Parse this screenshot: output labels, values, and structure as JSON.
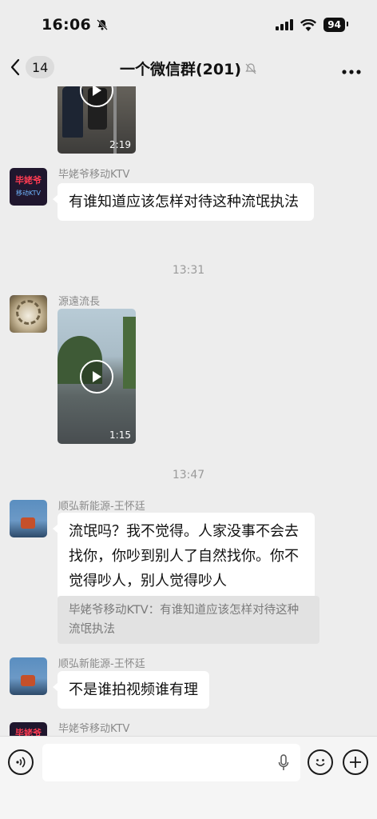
{
  "status_bar": {
    "time": "16:06",
    "battery": "94"
  },
  "nav": {
    "unread_count": "14",
    "title": "一个微信群(201)"
  },
  "messages": {
    "video1_duration": "2:19",
    "msg1_sender": "毕姥爷移动KTV",
    "msg1_avatar_text": "毕姥爷",
    "msg1_avatar_sub": "移动KTV",
    "msg1_text": "有谁知道应该怎样对待这种流氓执法",
    "time1": "13:31",
    "msg2_sender": "源遠流長",
    "video2_duration": "1:15",
    "time2": "13:47",
    "msg3_sender": "顺弘新能源-王怀廷",
    "msg3_text": "流氓吗？我不觉得。人家没事不会去找你，你吵到别人了自然找你。你不觉得吵人，别人觉得吵人",
    "msg3_quote": "毕姥爷移动KTV：有谁知道应该怎样对待这种流氓执法",
    "msg4_sender": "顺弘新能源-王怀廷",
    "msg4_text": "不是谁拍视频谁有理",
    "msg5_sender": "毕姥爷移动KTV",
    "msg5_avatar_text": "毕姥爷"
  },
  "icons": {
    "mute": "bell-slash-icon",
    "voice": "voice-icon",
    "mic": "mic-icon",
    "emoji": "emoji-icon",
    "plus": "plus-icon",
    "more": "more-dots-icon",
    "back": "chevron-left-icon"
  }
}
